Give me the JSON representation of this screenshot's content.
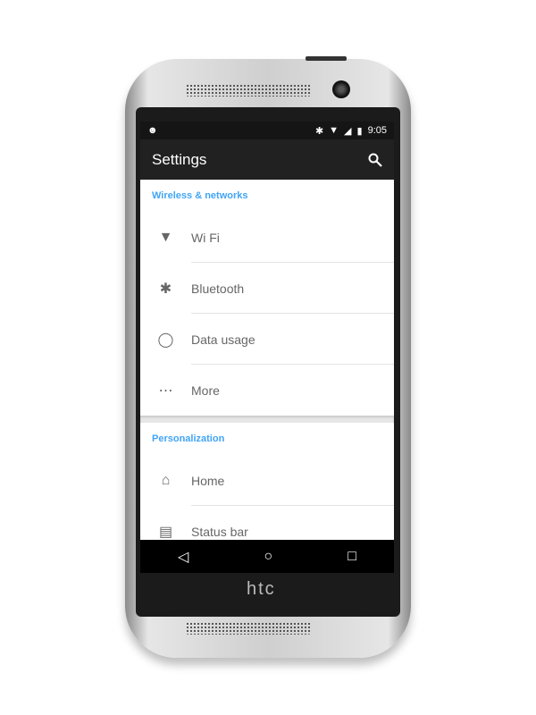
{
  "device": {
    "brand": "htc"
  },
  "status_bar": {
    "time": "9:05",
    "icons": [
      "cyanogen-icon",
      "bluetooth-icon",
      "wifi-icon",
      "no-sim-icon",
      "battery-charging-icon"
    ]
  },
  "toolbar": {
    "title": "Settings",
    "search_icon": "search-icon"
  },
  "sections": [
    {
      "header": "Wireless & networks",
      "items": [
        {
          "label": "Wi Fi",
          "icon": "wifi-icon"
        },
        {
          "label": "Bluetooth",
          "icon": "bluetooth-icon"
        },
        {
          "label": "Data usage",
          "icon": "data-usage-icon"
        },
        {
          "label": "More",
          "icon": "more-icon"
        }
      ]
    },
    {
      "header": "Personalization",
      "items": [
        {
          "label": "Home",
          "icon": "home-icon"
        },
        {
          "label": "Status bar",
          "icon": "status-bar-icon"
        }
      ]
    }
  ],
  "navigation": [
    "back",
    "home",
    "recents"
  ],
  "colors": {
    "accent": "#42a5f5",
    "toolbar": "#212121"
  }
}
